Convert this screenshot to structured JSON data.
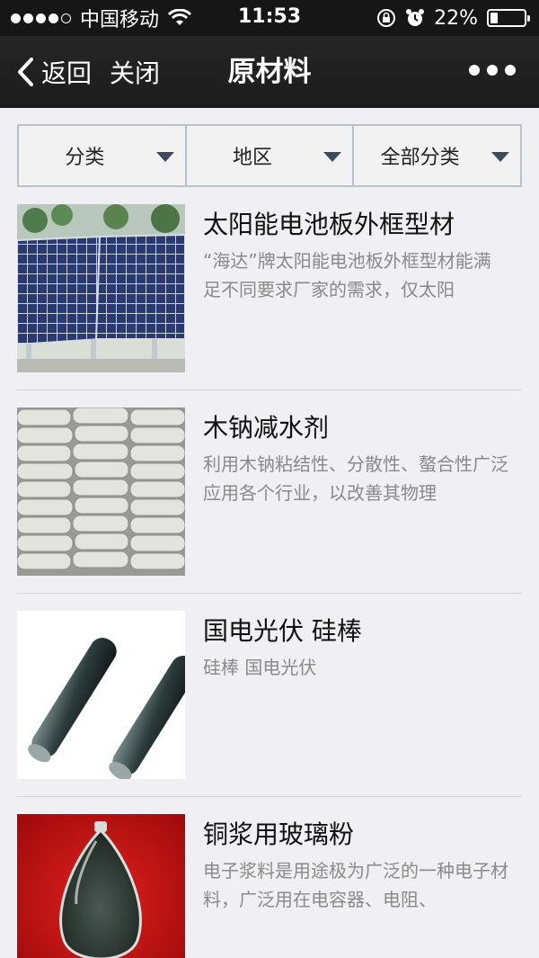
{
  "status_bar": {
    "carrier": "中国移动",
    "time": "11:53",
    "battery_percent": "22%",
    "battery_level": 0.22,
    "signal_bars_filled": 4,
    "signal_bars_total": 5
  },
  "nav": {
    "back_label": "返回",
    "close_label": "关闭",
    "title": "原材料"
  },
  "filters": [
    {
      "label": "分类"
    },
    {
      "label": "地区"
    },
    {
      "label": "全部分类"
    }
  ],
  "products": [
    {
      "title": "太阳能电池板外框型材",
      "desc": "“海达”牌太阳能电池板外框型材能满足不同要求厂家的需求，仅太阳",
      "image": "solar-panel-image"
    },
    {
      "title": "木钠减水剂",
      "desc": "利用木钠粘结性、分散性、螯合性广泛应用各个行业，以改善其物理",
      "image": "cement-bags-image"
    },
    {
      "title": "国电光伏 硅棒",
      "desc": "硅棒 国电光伏",
      "image": "silicon-rod-image"
    },
    {
      "title": "铜浆用玻璃粉",
      "desc": "电子浆料是用途极为广泛的一种电子材料，广泛用在电容器、电阻、",
      "image": "glass-powder-image"
    }
  ],
  "colors": {
    "status_bar_bg": "#161616",
    "nav_bg": "#1f1f1f",
    "page_bg": "#efeff4",
    "filter_border": "#b9c2cc",
    "arrow": "#3b4a5c",
    "desc_text": "#8a8a8a"
  }
}
